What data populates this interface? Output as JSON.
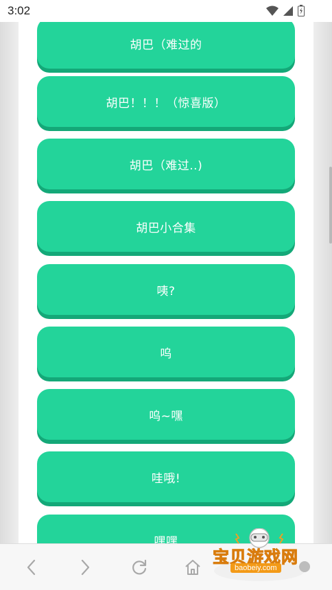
{
  "status_bar": {
    "time": "3:02"
  },
  "buttons": [
    {
      "label": "胡巴（难过的"
    },
    {
      "label": "胡巴！！！（惊喜版）"
    },
    {
      "label": "胡巴（难过..)"
    },
    {
      "label": "胡巴小合集"
    },
    {
      "label": "咦?"
    },
    {
      "label": "呜"
    },
    {
      "label": "呜~嘿"
    },
    {
      "label": "哇哦!"
    },
    {
      "label": "嘿嘿"
    }
  ],
  "bottom_nav": {
    "icons": [
      "back-icon",
      "forward-icon",
      "refresh-icon",
      "home-icon"
    ]
  },
  "watermark": {
    "name": "宝贝游戏网",
    "url": "baobeiy.com"
  },
  "colors": {
    "button": "#23d49a",
    "button_shadow": "#14a878",
    "watermark": "#f7a21b"
  }
}
